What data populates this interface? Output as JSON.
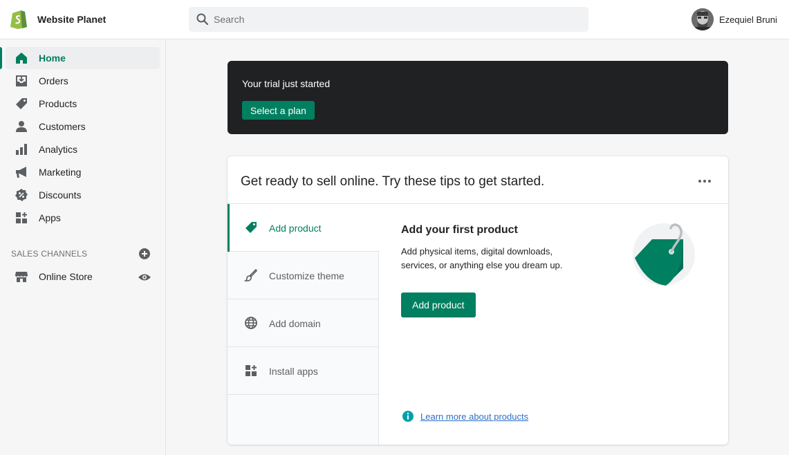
{
  "topbar": {
    "store_name": "Website Planet",
    "search_placeholder": "Search",
    "user_name": "Ezequiel Bruni"
  },
  "sidebar": {
    "items": [
      {
        "label": "Home",
        "icon": "home-icon",
        "active": true
      },
      {
        "label": "Orders",
        "icon": "orders-icon"
      },
      {
        "label": "Products",
        "icon": "tag-icon"
      },
      {
        "label": "Customers",
        "icon": "person-icon"
      },
      {
        "label": "Analytics",
        "icon": "bar-chart-icon"
      },
      {
        "label": "Marketing",
        "icon": "megaphone-icon"
      },
      {
        "label": "Discounts",
        "icon": "discount-icon"
      },
      {
        "label": "Apps",
        "icon": "apps-icon"
      }
    ],
    "sales_channels_heading": "SALES CHANNELS",
    "channels": [
      {
        "label": "Online Store",
        "icon": "store-icon"
      }
    ]
  },
  "trial": {
    "message": "Your trial just started",
    "button_label": "Select a plan"
  },
  "tips": {
    "title": "Get ready to sell online. Try these tips to get started.",
    "tabs": [
      {
        "label": "Add product",
        "icon": "tag-icon",
        "selected": true
      },
      {
        "label": "Customize theme",
        "icon": "brush-icon"
      },
      {
        "label": "Add domain",
        "icon": "globe-icon"
      },
      {
        "label": "Install apps",
        "icon": "apps-icon"
      }
    ],
    "panel": {
      "title": "Add your first product",
      "description": "Add physical items, digital downloads, services, or anything else you dream up.",
      "button_label": "Add product",
      "link_text": "Learn more about products"
    }
  },
  "colors": {
    "accent": "#008060",
    "banner_bg": "#202123",
    "link": "#2c6ecb"
  }
}
